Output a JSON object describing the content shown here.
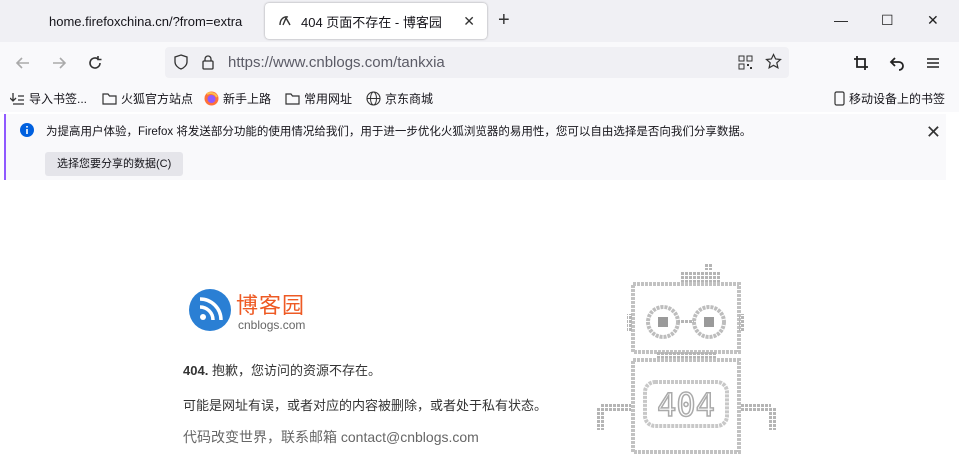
{
  "tabs": [
    {
      "label": "home.firefoxchina.cn/?from=extra"
    },
    {
      "label": "404 页面不存在 - 博客园"
    }
  ],
  "newtab_label": "+",
  "window_controls": {
    "minimize": "—",
    "maximize": "☐",
    "close": "✕"
  },
  "url": "https://www.cnblogs.com/tankxia",
  "url_display": {
    "host": "https://www.cnblogs.com",
    "path": "/tankxia"
  },
  "bookmarks": [
    {
      "label": "导入书签...",
      "icon": "import-icon"
    },
    {
      "label": "火狐官方站点",
      "icon": "folder-icon"
    },
    {
      "label": "新手上路",
      "icon": "firefox-icon"
    },
    {
      "label": "常用网址",
      "icon": "folder-icon"
    },
    {
      "label": "京东商城",
      "icon": "globe-icon"
    }
  ],
  "mobile_bookmarks": "移动设备上的书签",
  "notification": {
    "text": "为提高用户体验，Firefox 将发送部分功能的使用情况给我们，用于进一步优化火狐浏览器的易用性，您可以自由选择是否向我们分享数据。",
    "button": "选择您要分享的数据(C)"
  },
  "page": {
    "logo_title": "博客园",
    "logo_sub": "cnblogs.com",
    "error_code": "404.",
    "error_msg": "抱歉，您访问的资源不存在。",
    "reason": "可能是网址有误，或者对应的内容被删除，或者处于私有状态。",
    "contact": "代码改变世界，联系邮箱 contact@cnblogs.com",
    "robot_label": "404"
  },
  "colors": {
    "accent": "#9059ff",
    "brand": "#ee5a24",
    "logo_blue": "#2a7fd4"
  }
}
